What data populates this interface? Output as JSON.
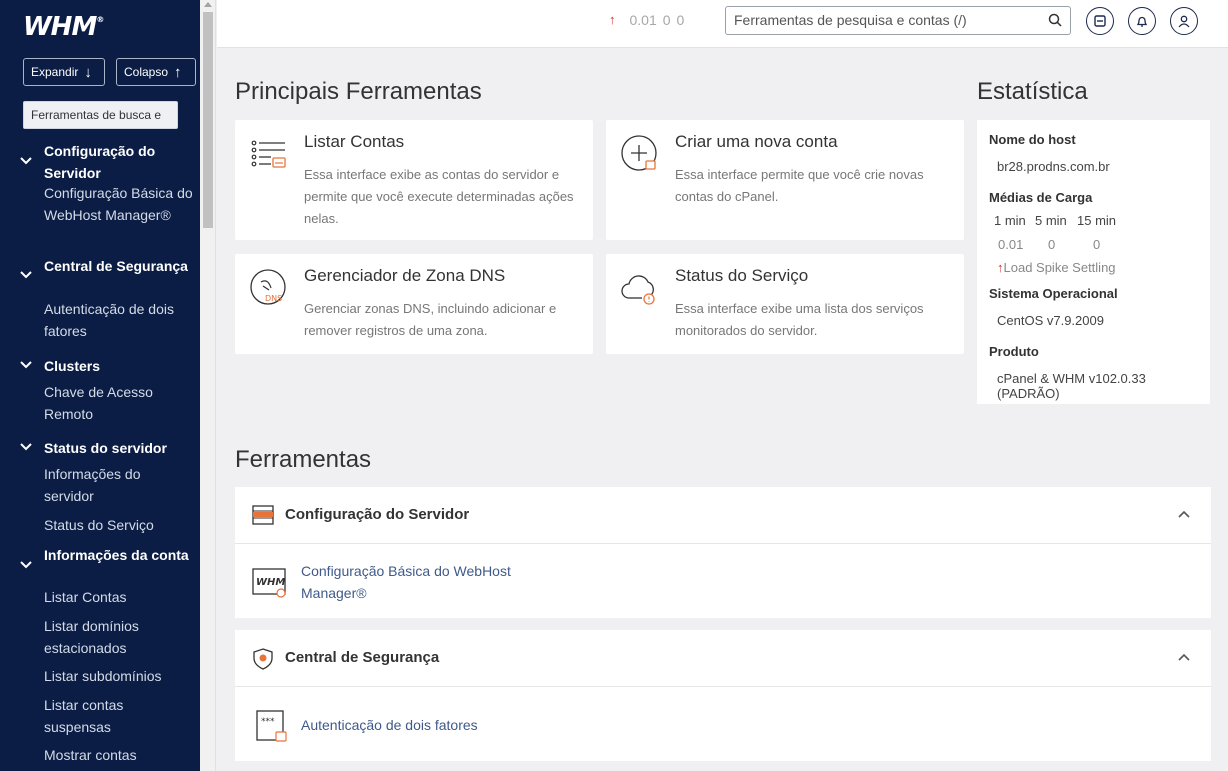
{
  "sidebar": {
    "logo": "WHM",
    "expand_label": "Expandir",
    "collapse_label": "Colapso",
    "search_placeholder": "Ferramentas de busca e",
    "sections": [
      {
        "title": "Configuração do Servidor",
        "items": [
          "Configuração Básica do WebHost Manager®"
        ]
      },
      {
        "title": "Central de Segurança",
        "items": [
          "Autenticação de dois fatores"
        ]
      },
      {
        "title": "Clusters",
        "items": [
          "Chave de Acesso Remoto"
        ]
      },
      {
        "title": "Status do servidor",
        "items": [
          "Informações do servidor",
          "Status do Serviço"
        ]
      },
      {
        "title": "Informações da conta",
        "items": [
          "Listar Contas",
          "Listar domínios estacionados",
          "Listar subdomínios",
          "Listar contas suspensas",
          "Mostrar contas"
        ]
      }
    ]
  },
  "topbar": {
    "load_values": [
      "0.01",
      "0",
      "0"
    ],
    "search_placeholder": "Ferramentas de pesquisa e contas (/)"
  },
  "main": {
    "top_tools_title": "Principais Ferramentas",
    "cards": [
      {
        "title": "Listar Contas",
        "desc": "Essa interface exibe as contas do servidor e permite que você execute determinadas ações nelas.",
        "icon": "list-accounts-icon"
      },
      {
        "title": "Criar uma nova conta",
        "desc": "Essa interface permite que você crie novas contas do cPanel.",
        "icon": "create-account-icon"
      },
      {
        "title": "Gerenciador de Zona DNS",
        "desc": "Gerenciar zonas DNS, incluindo adicionar e remover registros de uma zona.",
        "icon": "dns-zone-icon"
      },
      {
        "title": "Status do Serviço",
        "desc": "Essa interface exibe uma lista dos serviços monitorados do servidor.",
        "icon": "service-status-icon"
      }
    ],
    "tools_title": "Ferramentas",
    "panels": [
      {
        "title": "Configuração do Servidor",
        "link": "Configuração Básica do WebHost Manager®"
      },
      {
        "title": "Central de Segurança",
        "link": "Autenticação de dois fatores"
      }
    ]
  },
  "stats": {
    "title": "Estatística",
    "hostname_label": "Nome do host",
    "hostname": "br28.prodns.com.br",
    "load_label": "Médias de Carga",
    "load_headers": [
      "1 min",
      "5 min",
      "15 min"
    ],
    "load_values": [
      "0.01",
      "0",
      "0"
    ],
    "load_note": "Load Spike Settling",
    "os_label": "Sistema Operacional",
    "os": "CentOS v7.9.2009",
    "product_label": "Produto",
    "product": "cPanel & WHM v102.0.33 (PADRÃO)"
  },
  "colors": {
    "sidebar_bg": "#0b1d44",
    "accent_orange": "#e8743b",
    "link": "#3f5a8a",
    "alert_red": "#d0342c"
  }
}
